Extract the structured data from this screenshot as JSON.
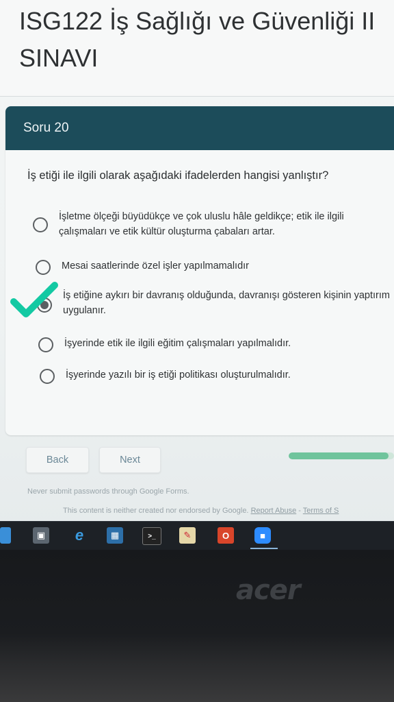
{
  "form": {
    "title": "ISG122 İş Sağlığı ve Güvenliği II SINAVI"
  },
  "question": {
    "header": "Soru 20",
    "text": "İş etiği ile ilgili olarak aşağıdaki ifadelerden hangisi yanlıştır?",
    "options": [
      {
        "label": "İşletme ölçeği büyüdükçe ve çok uluslu hâle geldikçe; etik ile ilgili çalışmaları ve etik kültür oluşturma çabaları artar.",
        "selected": false
      },
      {
        "label": "Mesai saatlerinde özel işler yapılmamalıdır",
        "selected": false
      },
      {
        "label": "İş etiğine aykırı bir davranış olduğunda, davranışı gösteren kişinin yaptırım uygulanır.",
        "selected": true
      },
      {
        "label": "İşyerinde etik ile ilgili eğitim çalışmaları yapılmalıdır.",
        "selected": false
      },
      {
        "label": "İşyerinde yazılı bir iş etiği politikası oluşturulmalıdır.",
        "selected": false
      }
    ],
    "annotation_color": "#13c9a3"
  },
  "nav": {
    "back_label": "Back",
    "next_label": "Next",
    "progress_fraction": 0.95,
    "progress_color": "#6fc49c"
  },
  "footer": {
    "warning": "Never submit passwords through Google Forms.",
    "disclaimer": "This content is neither created nor endorsed by Google.",
    "report_abuse": "Report Abuse",
    "separator": " - ",
    "terms": "Terms of S"
  },
  "taskbar": {
    "icons": [
      "task-view-icon",
      "edge-icon",
      "store-icon",
      "terminal-icon",
      "paint-icon",
      "office-icon",
      "zoom-icon"
    ]
  },
  "device": {
    "brand": "acer"
  }
}
